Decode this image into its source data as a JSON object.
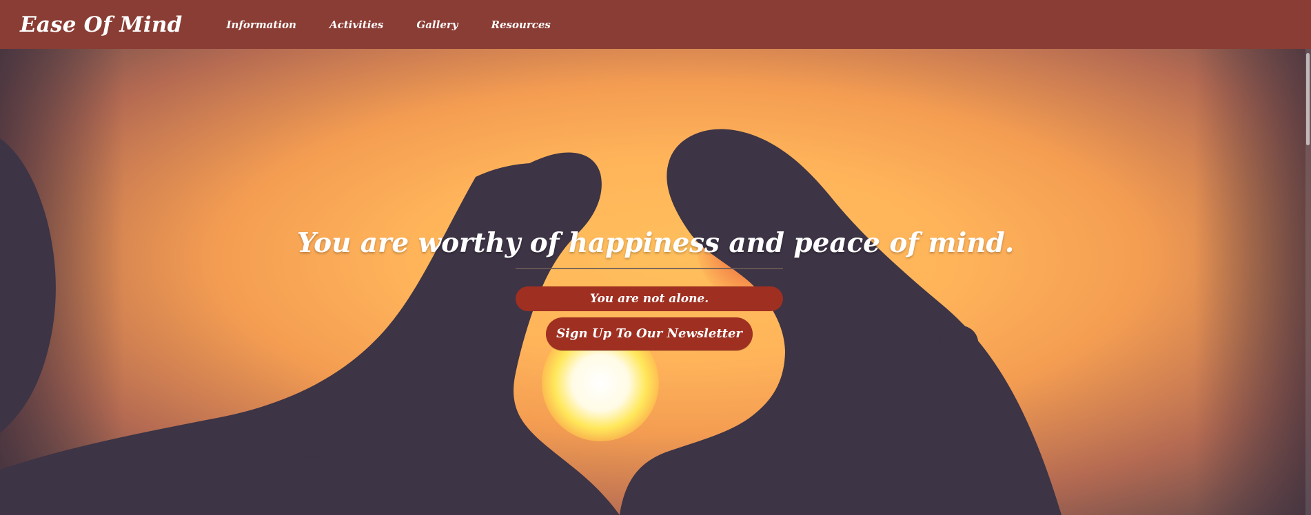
{
  "header": {
    "brand": "Ease Of Mind",
    "nav": [
      {
        "label": "Information"
      },
      {
        "label": "Activities"
      },
      {
        "label": "Gallery"
      },
      {
        "label": "Resources"
      }
    ]
  },
  "hero": {
    "headline": "You are worthy of happiness and peace of mind.",
    "subtitle": "You are not alone.",
    "cta_label": "Sign Up To Our Newsletter"
  },
  "colors": {
    "navbar": "#8a3d34",
    "button": "#9f2f21",
    "text": "#ffffff",
    "hero_orange": "#ffb45a",
    "silhouette": "#3d3445"
  }
}
